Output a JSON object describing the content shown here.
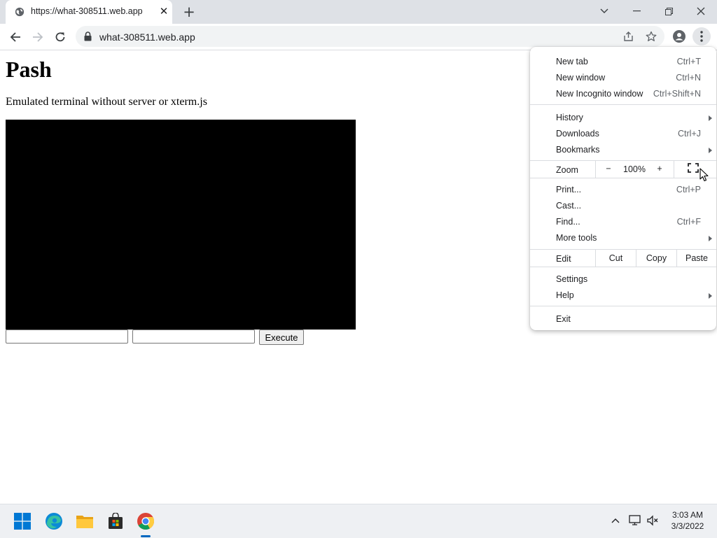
{
  "tab": {
    "title": "https://what-308511.web.app",
    "close_glyph": "✕",
    "favicon": "globe-icon"
  },
  "new_tab_glyph": "+",
  "window_controls": [
    "minimize",
    "restore",
    "close"
  ],
  "address_bar": {
    "url": "what-308511.web.app",
    "secure_icon": "lock-icon"
  },
  "page": {
    "title": "Pash",
    "description": "Emulated terminal without server or xterm.js",
    "input_1_value": "",
    "input_2_value": "",
    "execute_label": "Execute",
    "terminal_color": "#000000"
  },
  "menu": {
    "group1": [
      {
        "label": "New tab",
        "shortcut": "Ctrl+T"
      },
      {
        "label": "New window",
        "shortcut": "Ctrl+N"
      },
      {
        "label": "New Incognito window",
        "shortcut": "Ctrl+Shift+N"
      }
    ],
    "group2": [
      {
        "label": "History",
        "submenu": true
      },
      {
        "label": "Downloads",
        "shortcut": "Ctrl+J"
      },
      {
        "label": "Bookmarks",
        "submenu": true
      }
    ],
    "zoom": {
      "label": "Zoom",
      "minus": "−",
      "value": "100%",
      "plus": "+"
    },
    "group3": [
      {
        "label": "Print...",
        "shortcut": "Ctrl+P"
      },
      {
        "label": "Cast..."
      },
      {
        "label": "Find...",
        "shortcut": "Ctrl+F"
      },
      {
        "label": "More tools",
        "submenu": true
      }
    ],
    "edit": {
      "label": "Edit",
      "cut": "Cut",
      "copy": "Copy",
      "paste": "Paste"
    },
    "group4": [
      {
        "label": "Settings"
      },
      {
        "label": "Help",
        "submenu": true
      }
    ],
    "exit": "Exit"
  },
  "taskbar": {
    "apps": [
      "windows-start-icon",
      "edge-icon",
      "file-explorer-icon",
      "store-icon",
      "chrome-icon"
    ],
    "active_app": "chrome-icon",
    "time": "3:03 AM",
    "date": "3/3/2022"
  },
  "colors": {
    "accent": "#0067c0",
    "tabstrip": "#dee1e6",
    "omnibox": "#f1f3f4"
  }
}
